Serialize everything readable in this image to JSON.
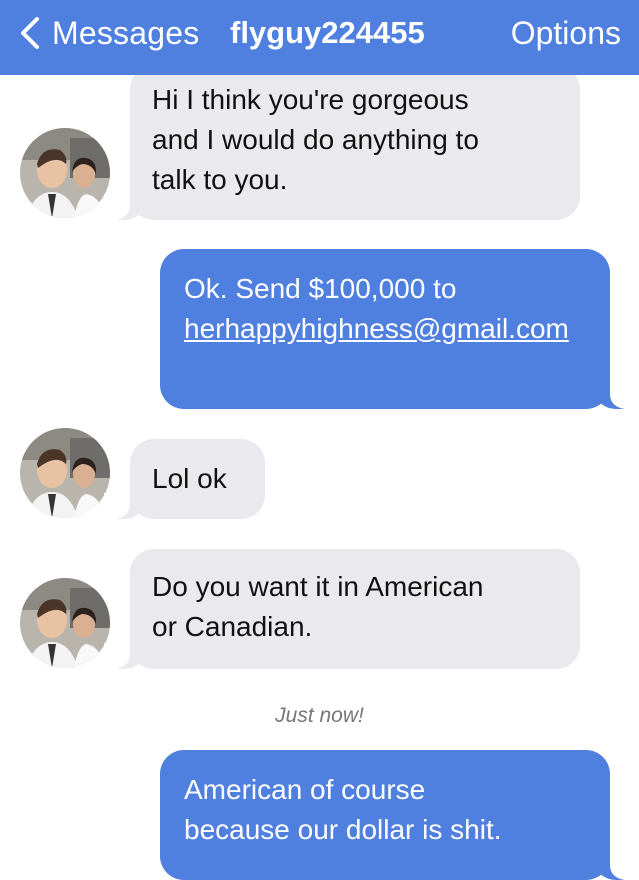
{
  "header": {
    "back_icon": "chevron-left-icon",
    "back_label": "Messages",
    "title": "flyguy224455",
    "options_label": "Options",
    "background": "#4f7fdf"
  },
  "colors": {
    "incoming_bubble": "#e9e9ee",
    "outgoing_bubble": "#4f7fdf",
    "timestamp": "#777777"
  },
  "messages": [
    {
      "direction": "incoming",
      "text": "Hi I think you're gorgeous\nand I would do anything to\ntalk to you."
    },
    {
      "direction": "outgoing",
      "text": "Ok. Send $100,000 to",
      "link_text": "herhappyhighness@gmail.com"
    },
    {
      "direction": "incoming",
      "text": "Lol ok"
    },
    {
      "direction": "incoming",
      "text": "Do you want it in American\nor Canadian."
    },
    {
      "direction": "outgoing",
      "text": "American of course\nbecause our dollar is shit."
    }
  ],
  "timestamp": "Just now!"
}
